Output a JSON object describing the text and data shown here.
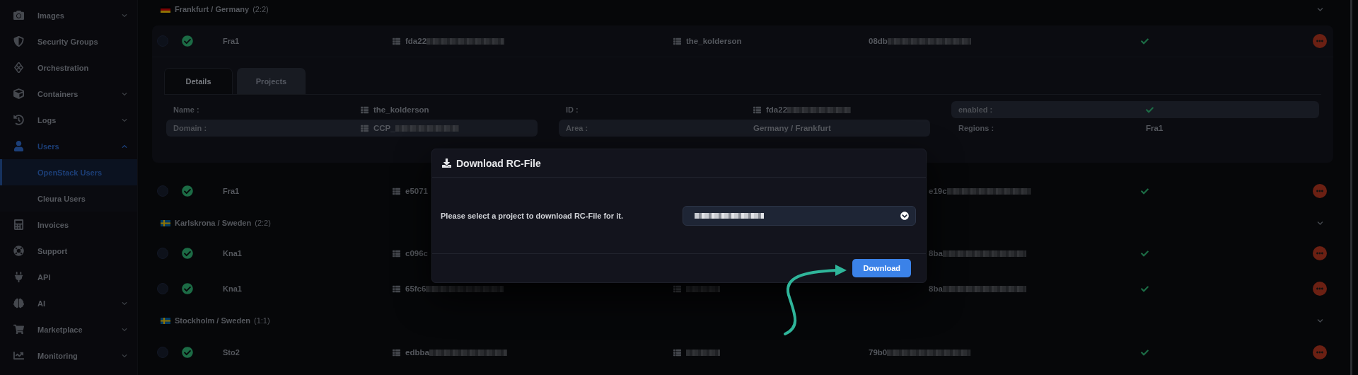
{
  "sidebar": {
    "items": [
      {
        "label": "Images",
        "expanded": false,
        "selected": false
      },
      {
        "label": "Security Groups",
        "selected": false
      },
      {
        "label": "Orchestration",
        "selected": false
      },
      {
        "label": "Containers",
        "expanded": false,
        "selected": false
      },
      {
        "label": "Logs",
        "expanded": false,
        "selected": false
      },
      {
        "label": "Users",
        "expanded": true,
        "selected": true,
        "children": [
          {
            "label": "OpenStack Users",
            "selected": true
          },
          {
            "label": "Cleura Users",
            "selected": false
          }
        ]
      },
      {
        "label": "Invoices",
        "selected": false
      },
      {
        "label": "Support",
        "selected": false
      },
      {
        "label": "API",
        "selected": false
      },
      {
        "label": "AI",
        "expanded": false,
        "selected": false
      },
      {
        "label": "Marketplace",
        "expanded": false,
        "selected": false
      },
      {
        "label": "Monitoring",
        "expanded": false,
        "selected": false
      }
    ]
  },
  "groups": [
    {
      "kind": "germany",
      "title": "Frankfurt / Germany",
      "count": "(2:2)",
      "rows": [
        {
          "name": "Fra1",
          "selected": false,
          "enabled": true,
          "expanded": true,
          "id": {
            "text": "fda22",
            "blurred": true
          },
          "project": {
            "text": "the_kolderson"
          },
          "column_4": {
            "text": "08db",
            "blurred": true,
            "covered": false
          },
          "details": {
            "tabs": [
              {
                "label": "Details",
                "selected": true
              },
              {
                "label": "Projects",
                "selected": false
              }
            ],
            "sections": [
              {
                "fields": [
                  {
                    "label": "Name :",
                    "kind": "id",
                    "value": "the_kolderson",
                    "shaded": false
                  },
                  {
                    "label": "Domain :",
                    "kind": "id",
                    "value": "CCP_",
                    "blurred": true,
                    "shaded": true
                  }
                ]
              },
              {
                "fields": [
                  {
                    "label": "ID :",
                    "kind": "id",
                    "value": "fda22",
                    "blurred": true,
                    "shaded": false
                  },
                  {
                    "label": "Area :",
                    "kind": "text",
                    "value": "Germany / Frankfurt",
                    "shaded": true
                  }
                ]
              },
              {
                "fields": [
                  {
                    "label": "enabled :",
                    "kind": "check",
                    "on": true,
                    "shaded": true
                  },
                  {
                    "label": "Regions :",
                    "kind": "text",
                    "value": "Fra1",
                    "shaded": false
                  }
                ]
              }
            ]
          }
        },
        {
          "name": "Fra1",
          "selected": false,
          "enabled": true,
          "expanded": false,
          "id": {
            "text": "e5071"
          },
          "project": null,
          "column_4": {
            "text": "e19c",
            "blurred": true,
            "covered": true
          }
        }
      ]
    },
    {
      "kind": "sweden",
      "title": "Karlskrona / Sweden",
      "count": "(2:2)",
      "rows": [
        {
          "name": "Kna1",
          "selected": false,
          "enabled": true,
          "expanded": false,
          "id": {
            "text": "c096c"
          },
          "project": null,
          "column_4": {
            "text": "8ba",
            "blurred": true,
            "covered": true
          }
        },
        {
          "name": "Kna1",
          "selected": false,
          "enabled": true,
          "expanded": false,
          "id": {
            "text": "65fc6",
            "blurred": true
          },
          "project": {
            "blurred": true
          },
          "column_4": {
            "text": "8ba",
            "blurred": true,
            "covered": true
          }
        }
      ]
    },
    {
      "kind": "sweden",
      "title": "Stockholm / Sweden",
      "count": "(1:1)",
      "rows": [
        {
          "name": "Sto2",
          "selected": false,
          "enabled": true,
          "expanded": false,
          "id": {
            "text": "edbba",
            "blurred": true
          },
          "project": {
            "blurred": true
          },
          "column_4": {
            "text": "79b0",
            "blurred": true,
            "covered": false
          }
        }
      ]
    }
  ],
  "modal": {
    "title": "Download RC-File",
    "prompt": "Please select a project to download RC-File for it.",
    "select": {
      "blurred": true
    },
    "button": "Download"
  }
}
